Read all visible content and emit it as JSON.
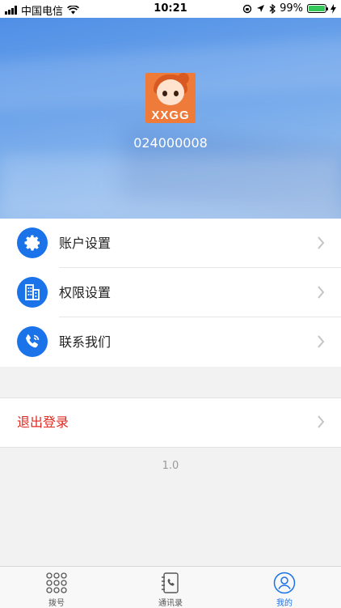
{
  "status_bar": {
    "carrier": "中国电信",
    "time": "10:21",
    "battery_percent": "99%",
    "battery_level": 0.99
  },
  "profile": {
    "logo_text": "XXGG",
    "account_id": "024000008"
  },
  "menu": {
    "items": [
      {
        "label": "账户设置",
        "icon": "gear-icon"
      },
      {
        "label": "权限设置",
        "icon": "building-icon"
      },
      {
        "label": "联系我们",
        "icon": "phone-icon"
      }
    ]
  },
  "logout": {
    "label": "退出登录"
  },
  "version": "1.0",
  "tabbar": {
    "tabs": [
      {
        "label": "拨号",
        "icon": "keypad-icon",
        "active": false
      },
      {
        "label": "通讯录",
        "icon": "contacts-book-icon",
        "active": false
      },
      {
        "label": "我的",
        "icon": "user-icon",
        "active": true
      }
    ]
  },
  "colors": {
    "accent": "#1a73e8",
    "logout": "#e0281f"
  }
}
